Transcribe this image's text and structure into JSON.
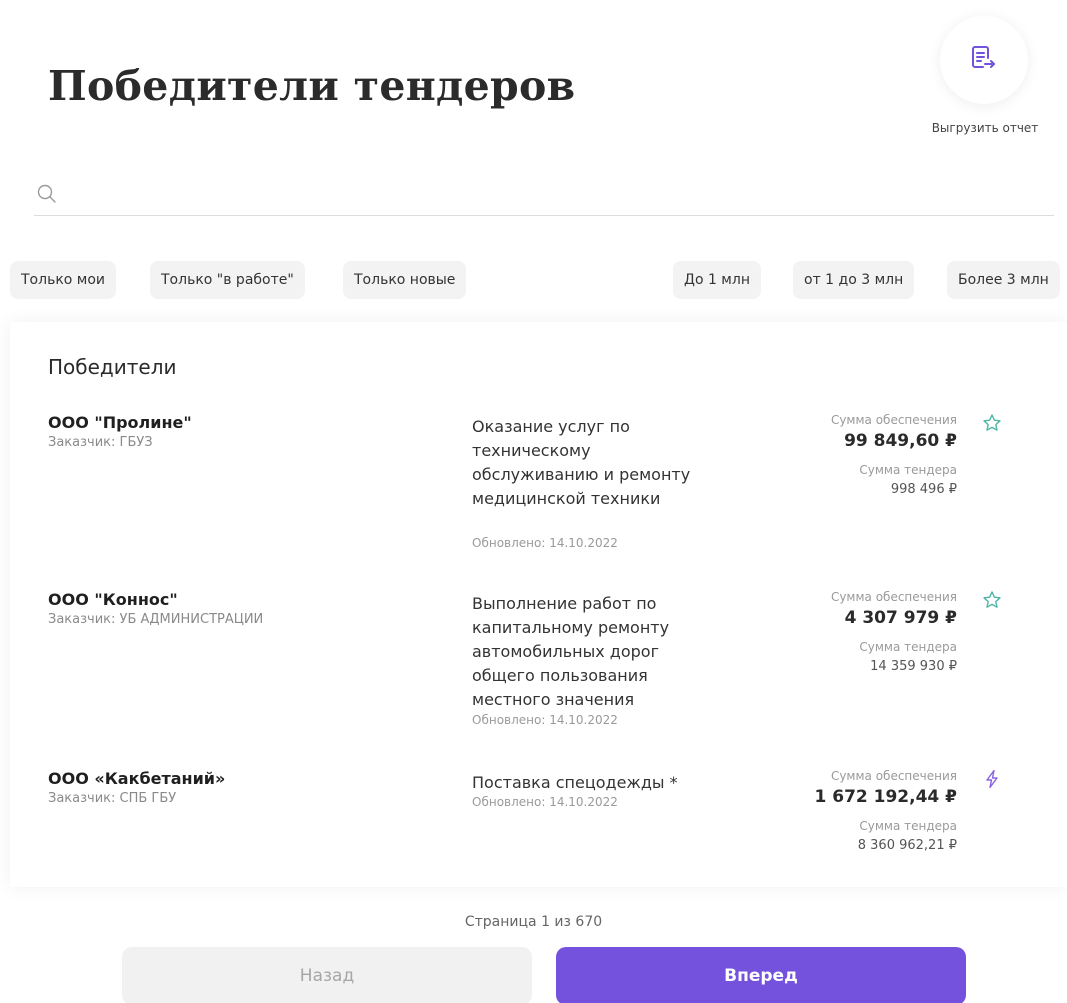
{
  "header": {
    "title": "Победители тендеров",
    "export_label": "Выгрузить отчет"
  },
  "search": {
    "placeholder": ""
  },
  "filters": {
    "status": [
      "Только мои",
      "Только \"в работе\"",
      "Только новые"
    ],
    "amount": [
      "До 1 млн",
      "от 1 до 3 млн",
      "Более 3 млн"
    ]
  },
  "winners": {
    "title": "Победители",
    "rows": [
      {
        "company": "ООО \"Пролине\"",
        "customer": "Заказчик: ГБУЗ",
        "description": "Оказание услуг по техническому обслуживанию и ремонту медицинской техники",
        "updated": "Обновлено: 14.10.2022",
        "security_label": "Сумма обеспечения",
        "security_value": "99 849,60 ₽",
        "tender_label": "Сумма тендера",
        "tender_value": "998 496 ₽",
        "icon": "star-icon"
      },
      {
        "company": "ООО \"Коннос\"",
        "customer": "Заказчик: УБ АДМИНИСТРАЦИИ",
        "description": "Выполнение работ по капитальному ремонту автомобильных дорог общего пользования местного значения",
        "updated": "Обновлено: 14.10.2022",
        "security_label": "Сумма обеспечения",
        "security_value": "4 307 979 ₽",
        "tender_label": "Сумма тендера",
        "tender_value": "14 359 930 ₽",
        "icon": "star-icon"
      },
      {
        "company": "ООО «Какбетаний»",
        "customer": "Заказчик: СПБ ГБУ",
        "description": "Поставка спецодежды *",
        "updated": "Обновлено: 14.10.2022",
        "security_label": "Сумма обеспечения",
        "security_value": "1 672 192,44 ₽",
        "tender_label": "Сумма тендера",
        "tender_value": "8 360 962,21 ₽",
        "icon": "lightning-icon"
      }
    ]
  },
  "pagination": {
    "info": "Страница 1 из 670",
    "back_label": "Назад",
    "next_label": "Вперед"
  },
  "colors": {
    "accent": "#7452dd",
    "star_icon": "#4db6a6",
    "lightning_icon": "#8a63e0"
  }
}
